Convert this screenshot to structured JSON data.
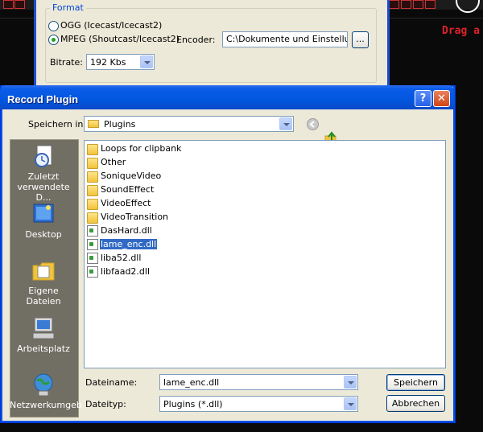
{
  "background": {
    "drag_text": "Drag a"
  },
  "format_panel": {
    "legend": "Format",
    "ogg_label": "OGG (Icecast/Icecast2)",
    "mpeg_label": "MPEG (Shoutcast/Icecast2)",
    "selected": "mpeg",
    "encoder_label": "Encoder:",
    "encoder_value": "C:\\Dokumente und Einstellung",
    "dots_label": "...",
    "bitrate_label": "Bitrate:",
    "bitrate_value": "192 Kbs"
  },
  "dialog": {
    "title": "Record Plugin",
    "help_label": "?",
    "close_label": "✕",
    "save_in_label": "Speichern in:",
    "save_in_value": "Plugins",
    "places": [
      {
        "label": "Zuletzt verwendete D...",
        "icon": "recent-documents-icon"
      },
      {
        "label": "Desktop",
        "icon": "desktop-icon"
      },
      {
        "label": "Eigene Dateien",
        "icon": "my-documents-icon"
      },
      {
        "label": "Arbeitsplatz",
        "icon": "my-computer-icon"
      },
      {
        "label": "Netzwerkumgeb",
        "icon": "network-icon"
      }
    ],
    "files": [
      {
        "name": "Loops for clipbank",
        "type": "folder"
      },
      {
        "name": "Other",
        "type": "folder"
      },
      {
        "name": "SoniqueVideo",
        "type": "folder"
      },
      {
        "name": "SoundEffect",
        "type": "folder"
      },
      {
        "name": "VideoEffect",
        "type": "folder"
      },
      {
        "name": "VideoTransition",
        "type": "folder"
      },
      {
        "name": "DasHard.dll",
        "type": "dll"
      },
      {
        "name": "lame_enc.dll",
        "type": "dll",
        "selected": true
      },
      {
        "name": "liba52.dll",
        "type": "dll"
      },
      {
        "name": "libfaad2.dll",
        "type": "dll"
      }
    ],
    "filename_label": "Dateiname:",
    "filename_value": "lame_enc.dll",
    "filetype_label": "Dateityp:",
    "filetype_value": "Plugins (*.dll)",
    "save_button": "Speichern",
    "cancel_button": "Abbrechen"
  }
}
